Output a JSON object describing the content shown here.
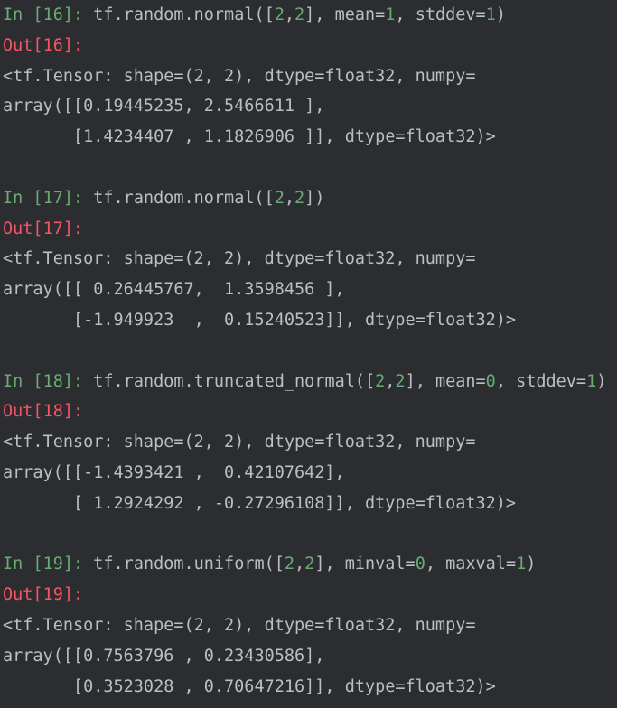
{
  "cells": [
    {
      "in_label": "In",
      "in_number": "16",
      "code_parts": [
        {
          "t": "tf.random.normal([",
          "k": "code"
        },
        {
          "t": "2",
          "k": "num"
        },
        {
          "t": ",",
          "k": "code"
        },
        {
          "t": "2",
          "k": "num"
        },
        {
          "t": "], mean=",
          "k": "code"
        },
        {
          "t": "1",
          "k": "num"
        },
        {
          "t": ", stddev=",
          "k": "code"
        },
        {
          "t": "1",
          "k": "num"
        },
        {
          "t": ")",
          "k": "code"
        }
      ],
      "out_label": "Out",
      "out_number": "16",
      "output_lines": [
        "<tf.Tensor: shape=(2, 2), dtype=float32, numpy=",
        "array([[0.19445235, 2.5466611 ],",
        "       [1.4234407 , 1.1826906 ]], dtype=float32)>"
      ]
    },
    {
      "in_label": "In",
      "in_number": "17",
      "code_parts": [
        {
          "t": "tf.random.normal([",
          "k": "code"
        },
        {
          "t": "2",
          "k": "num"
        },
        {
          "t": ",",
          "k": "code"
        },
        {
          "t": "2",
          "k": "num"
        },
        {
          "t": "])",
          "k": "code"
        }
      ],
      "out_label": "Out",
      "out_number": "17",
      "output_lines": [
        "<tf.Tensor: shape=(2, 2), dtype=float32, numpy=",
        "array([[ 0.26445767,  1.3598456 ],",
        "       [-1.949923  ,  0.15240523]], dtype=float32)>"
      ]
    },
    {
      "in_label": "In",
      "in_number": "18",
      "code_parts": [
        {
          "t": "tf.random.truncated_normal([",
          "k": "code"
        },
        {
          "t": "2",
          "k": "num"
        },
        {
          "t": ",",
          "k": "code"
        },
        {
          "t": "2",
          "k": "num"
        },
        {
          "t": "], mean=",
          "k": "code"
        },
        {
          "t": "0",
          "k": "num"
        },
        {
          "t": ", stddev=",
          "k": "code"
        },
        {
          "t": "1",
          "k": "num"
        },
        {
          "t": ")",
          "k": "code"
        }
      ],
      "out_label": "Out",
      "out_number": "18",
      "output_lines": [
        "<tf.Tensor: shape=(2, 2), dtype=float32, numpy=",
        "array([[-1.4393421 ,  0.42107642],",
        "       [ 1.2924292 , -0.27296108]], dtype=float32)>"
      ]
    },
    {
      "in_label": "In",
      "in_number": "19",
      "code_parts": [
        {
          "t": "tf.random.uniform([",
          "k": "code"
        },
        {
          "t": "2",
          "k": "num"
        },
        {
          "t": ",",
          "k": "code"
        },
        {
          "t": "2",
          "k": "num"
        },
        {
          "t": "], minval=",
          "k": "code"
        },
        {
          "t": "0",
          "k": "num"
        },
        {
          "t": ", maxval=",
          "k": "code"
        },
        {
          "t": "1",
          "k": "num"
        },
        {
          "t": ")",
          "k": "code"
        }
      ],
      "out_label": "Out",
      "out_number": "19",
      "output_lines": [
        "<tf.Tensor: shape=(2, 2), dtype=float32, numpy=",
        "array([[0.7563796 , 0.23430586],",
        "       [0.3523028 , 0.70647216]], dtype=float32)>"
      ]
    }
  ],
  "colors": {
    "background": "#2b2d30",
    "text": "#bcbec4",
    "in_prompt": "#6aab73",
    "out_prompt": "#f75464",
    "number_literal": "#6aab73"
  }
}
